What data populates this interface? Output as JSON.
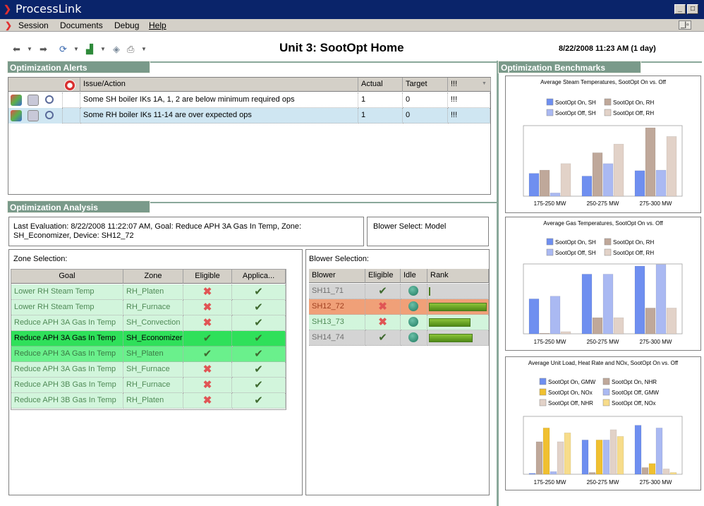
{
  "window": {
    "title": "ProcessLink",
    "minimize": "_",
    "maximize": "□",
    "restore": "_|▫"
  },
  "menu": [
    {
      "label": "Session"
    },
    {
      "label": "Documents"
    },
    {
      "label": "Debug"
    },
    {
      "label": "Help"
    }
  ],
  "toolbar": {
    "back_icon": "arrow-left",
    "forward_icon": "arrow-right",
    "refresh_icon": "refresh",
    "chart_icon": "bar-chart",
    "print_icon": "printer"
  },
  "header": {
    "title": "Unit 3: SootOpt Home",
    "timestamp": "8/22/2008 11:23 AM (1 day)"
  },
  "alerts": {
    "section_title": "Optimization Alerts",
    "columns": [
      "Issue/Action",
      "Actual",
      "Target",
      "!!!"
    ],
    "rows": [
      {
        "issue": "Some SH boiler IKs 1A, 1, 2 are below minimum required ops",
        "actual": "1",
        "target": "0",
        "flag": "!!!"
      },
      {
        "issue": "Some RH boiler IKs 11-14 are over expected ops",
        "actual": "1",
        "target": "0",
        "flag": "!!!"
      }
    ]
  },
  "analysis": {
    "section_title": "Optimization Analysis",
    "last_evaluation": "Last Evaluation: 8/22/2008 11:22:07 AM, Goal: Reduce APH 3A Gas In Temp, Zone: SH_Economizer, Device: SH12_72",
    "blower_select": "Blower Select: Model",
    "zone_label": "Zone Selection:",
    "zone_columns": [
      "Goal",
      "Zone",
      "Eligible",
      "Applica..."
    ],
    "zones": [
      {
        "goal": "Lower RH Steam Temp",
        "zone": "RH_Platen",
        "eligible": "✖",
        "applicable": "✔"
      },
      {
        "goal": "Lower RH Steam Temp",
        "zone": "RH_Furnace",
        "eligible": "✖",
        "applicable": "✔"
      },
      {
        "goal": "Reduce APH 3A Gas In Temp",
        "zone": "SH_Convection",
        "eligible": "✖",
        "applicable": "✔"
      },
      {
        "goal": "Reduce APH 3A Gas In Temp",
        "zone": "SH_Economizer",
        "eligible": "✔",
        "applicable": "✔"
      },
      {
        "goal": "Reduce APH 3A Gas In Temp",
        "zone": "SH_Platen",
        "eligible": "✔",
        "applicable": "✔"
      },
      {
        "goal": "Reduce APH 3A Gas In Temp",
        "zone": "SH_Furnace",
        "eligible": "✖",
        "applicable": "✔"
      },
      {
        "goal": "Reduce APH 3B Gas In Temp",
        "zone": "RH_Furnace",
        "eligible": "✖",
        "applicable": "✔"
      },
      {
        "goal": "Reduce APH 3B Gas In Temp",
        "zone": "RH_Platen",
        "eligible": "✖",
        "applicable": "✔"
      }
    ],
    "blower_label": "Blower Selection:",
    "blower_columns": [
      "Blower",
      "Eligible",
      "Idle",
      "Rank"
    ],
    "blowers": [
      {
        "name": "SH11_71",
        "eligible": "✔",
        "rank": 0.02
      },
      {
        "name": "SH12_72",
        "eligible": "✖",
        "rank": 1.0
      },
      {
        "name": "SH13_73",
        "eligible": "✖",
        "rank": 0.72
      },
      {
        "name": "SH14_74",
        "eligible": "✔",
        "rank": 0.76
      }
    ]
  },
  "benchmarks": {
    "section_title": "Optimization Benchmarks",
    "colors": {
      "on_sh": "#6f8ff0",
      "on_rh": "#bfa89a",
      "off_sh": "#aab9f2",
      "off_rh": "#e2d2c8",
      "on_nox": "#f0c030",
      "off_nox": "#f7dc8a"
    }
  },
  "chart_data": [
    {
      "type": "bar",
      "title": "Average Steam Temperatures, SootOpt On vs. Off",
      "categories": [
        "175-250 MW",
        "250-275 MW",
        "275-300 MW"
      ],
      "series": [
        {
          "name": "SootOpt On, SH",
          "values": [
            0.42,
            0.37,
            0.47
          ]
        },
        {
          "name": "SootOpt On, RH",
          "values": [
            0.48,
            0.8,
            1.26
          ]
        },
        {
          "name": "SootOpt Off, SH",
          "values": [
            0.06,
            0.6,
            0.48
          ]
        },
        {
          "name": "SootOpt Off, RH",
          "values": [
            0.6,
            0.96,
            1.1
          ]
        }
      ],
      "ylim": [
        0,
        1.3
      ]
    },
    {
      "type": "bar",
      "title": "Average Gas Temperatures, SootOpt On vs. Off",
      "categories": [
        "175-250 MW",
        "250-275 MW",
        "275-300 MW"
      ],
      "series": [
        {
          "name": "SootOpt On, SH",
          "values": [
            0.65,
            1.11,
            1.26
          ]
        },
        {
          "name": "SootOpt On, RH",
          "values": [
            0.01,
            0.3,
            0.48
          ]
        },
        {
          "name": "SootOpt Off, SH",
          "values": [
            0.7,
            1.11,
            1.29
          ]
        },
        {
          "name": "SootOpt Off, RH",
          "values": [
            0.04,
            0.3,
            0.48
          ]
        }
      ],
      "ylim": [
        0,
        1.3
      ]
    },
    {
      "type": "bar",
      "title": "Average Unit Load, Heat Rate and NOx, SootOpt On vs. Off",
      "categories": [
        "175-250 MW",
        "250-275 MW",
        "275-300 MW"
      ],
      "series": [
        {
          "name": "SootOpt On, GMW",
          "values": [
            0.02,
            0.77,
            1.1
          ]
        },
        {
          "name": "SootOpt On, NHR",
          "values": [
            0.73,
            0.04,
            0.15
          ]
        },
        {
          "name": "SootOpt On, NOx",
          "values": [
            1.04,
            0.77,
            0.24
          ]
        },
        {
          "name": "SootOpt Off, GMW",
          "values": [
            0.06,
            0.77,
            1.04
          ]
        },
        {
          "name": "SootOpt Off, NHR",
          "values": [
            0.73,
            1.0,
            0.12
          ]
        },
        {
          "name": "SootOpt Off, NOx",
          "values": [
            0.93,
            0.85,
            0.04
          ]
        }
      ],
      "ylim": [
        0,
        1.3
      ]
    }
  ]
}
